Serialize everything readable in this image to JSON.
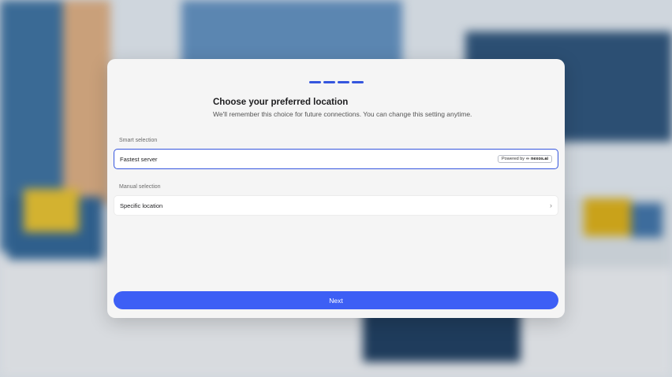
{
  "stepper": {
    "total_steps": 4,
    "accent": "#3556de"
  },
  "header": {
    "title": "Choose your preferred location",
    "subtitle": "We'll remember this choice for future connections. You can change this setting anytime."
  },
  "smart": {
    "section_label": "Smart selection",
    "option_label": "Fastest server",
    "badge_prefix": "Powered by",
    "badge_logo": "∞",
    "badge_brand": "nexos.ai"
  },
  "manual": {
    "section_label": "Manual selection",
    "option_label": "Specific location",
    "chevron": "›"
  },
  "footer": {
    "next_label": "Next",
    "button_color": "#3d5ff5"
  }
}
